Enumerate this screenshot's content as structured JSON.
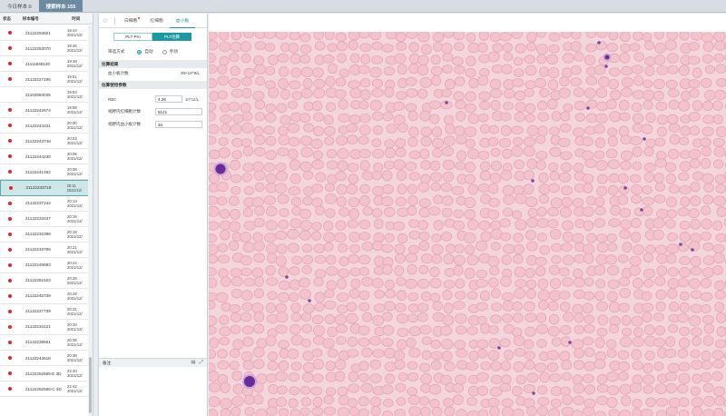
{
  "top_tabs": [
    {
      "label": "今日样本 0"
    },
    {
      "label": "搜索样本 155"
    }
  ],
  "list": {
    "headers": {
      "status": "状态",
      "sample_id": "样本编号",
      "time": "时间"
    },
    "rows": [
      {
        "id": "21122253821",
        "time": "19:44",
        "date": "2021/12/",
        "status": "red"
      },
      {
        "id": "21122253070",
        "time": "19:46",
        "date": "2021/12/",
        "status": "red"
      },
      {
        "id": "21111948120",
        "time": "19:48",
        "date": "2021/12/",
        "status": "red"
      },
      {
        "id": "21122227195",
        "time": "19:51",
        "date": "2021/12/",
        "status": "red"
      },
      {
        "id": "21102584045",
        "time": "19:53",
        "date": "2021/12/",
        "status": "none"
      },
      {
        "id": "21122242674",
        "time": "19:58",
        "date": "2021/12/",
        "status": "red"
      },
      {
        "id": "21122244231",
        "time": "20:00",
        "date": "2021/12/",
        "status": "red"
      },
      {
        "id": "21122243748",
        "time": "20:03",
        "date": "2021/12/",
        "status": "red"
      },
      {
        "id": "21122244230",
        "time": "20:06",
        "date": "2021/12/",
        "status": "red"
      },
      {
        "id": "21122241462",
        "time": "20:08",
        "date": "2021/12/",
        "status": "red"
      },
      {
        "id": "21122233719",
        "time": "20:11",
        "date": "2021/12/",
        "status": "red",
        "selected": true
      },
      {
        "id": "21122237244",
        "time": "20:13",
        "date": "2021/12/",
        "status": "red"
      },
      {
        "id": "21122233437",
        "time": "20:16",
        "date": "2021/12/",
        "status": "red"
      },
      {
        "id": "21122232398",
        "time": "20:19",
        "date": "2021/12/",
        "status": "red"
      },
      {
        "id": "21122233796",
        "time": "20:21",
        "date": "2021/12/",
        "status": "red"
      },
      {
        "id": "21122246683",
        "time": "20:24",
        "date": "2021/12/",
        "status": "red"
      },
      {
        "id": "21122251523",
        "time": "20:26",
        "date": "2021/12/",
        "status": "red"
      },
      {
        "id": "21122245739",
        "time": "20:28",
        "date": "2021/12/",
        "status": "red"
      },
      {
        "id": "21122227739",
        "time": "20:31",
        "date": "2021/12/",
        "status": "red"
      },
      {
        "id": "21122234121",
        "time": "20:33",
        "date": "2021/12/",
        "status": "red"
      },
      {
        "id": "21122238551",
        "time": "20:36",
        "date": "2021/12/",
        "status": "red"
      },
      {
        "id": "21122243618",
        "time": "20:38",
        "date": "2021/12/",
        "status": "red"
      },
      {
        "id": "21122252565-E 3D",
        "time": "22:40",
        "date": "2021/12/",
        "status": "red"
      },
      {
        "id": "21122252565-C 3D",
        "time": "22:42",
        "date": "2021/12/",
        "status": "red"
      }
    ]
  },
  "panel": {
    "tabs": [
      {
        "label": "白细胞",
        "badge": true
      },
      {
        "label": "红细胞",
        "badge": false
      },
      {
        "label": "血小板",
        "badge": false,
        "active": true
      }
    ],
    "segments": [
      {
        "label": "PLT-Pro",
        "active": false
      },
      {
        "label": "PLT估算",
        "active": true
      }
    ],
    "filter_mode": {
      "label": "筛选方式",
      "auto": "自动",
      "manual": "手动"
    },
    "count_result": {
      "title": "估算结果",
      "key": "血小板计数",
      "value": "39×10^9/L"
    },
    "params": {
      "title": "估算使用参数",
      "rbc_label": "RBC",
      "rbc_value": "4.26",
      "rbc_unit": "10^12/L",
      "fov_rbc_label": "视野内红细胞计数",
      "fov_rbc_value": "5121",
      "fov_plt_label": "视野内血小板计数",
      "fov_plt_value": "34"
    },
    "remark_label": "备注"
  },
  "colors": {
    "accent": "#1a9aa0",
    "status_red": "#e0262f",
    "smear_bg": "#f3d5dc",
    "rbc_fill": "#f2c2cd",
    "rbc_stroke": "#e6a7b6",
    "wbc_nucleus": "#6a2a9a",
    "platelet": "#7a4aa8"
  },
  "icons": [
    "star-icon",
    "screenshot-icon",
    "expand-icon"
  ]
}
